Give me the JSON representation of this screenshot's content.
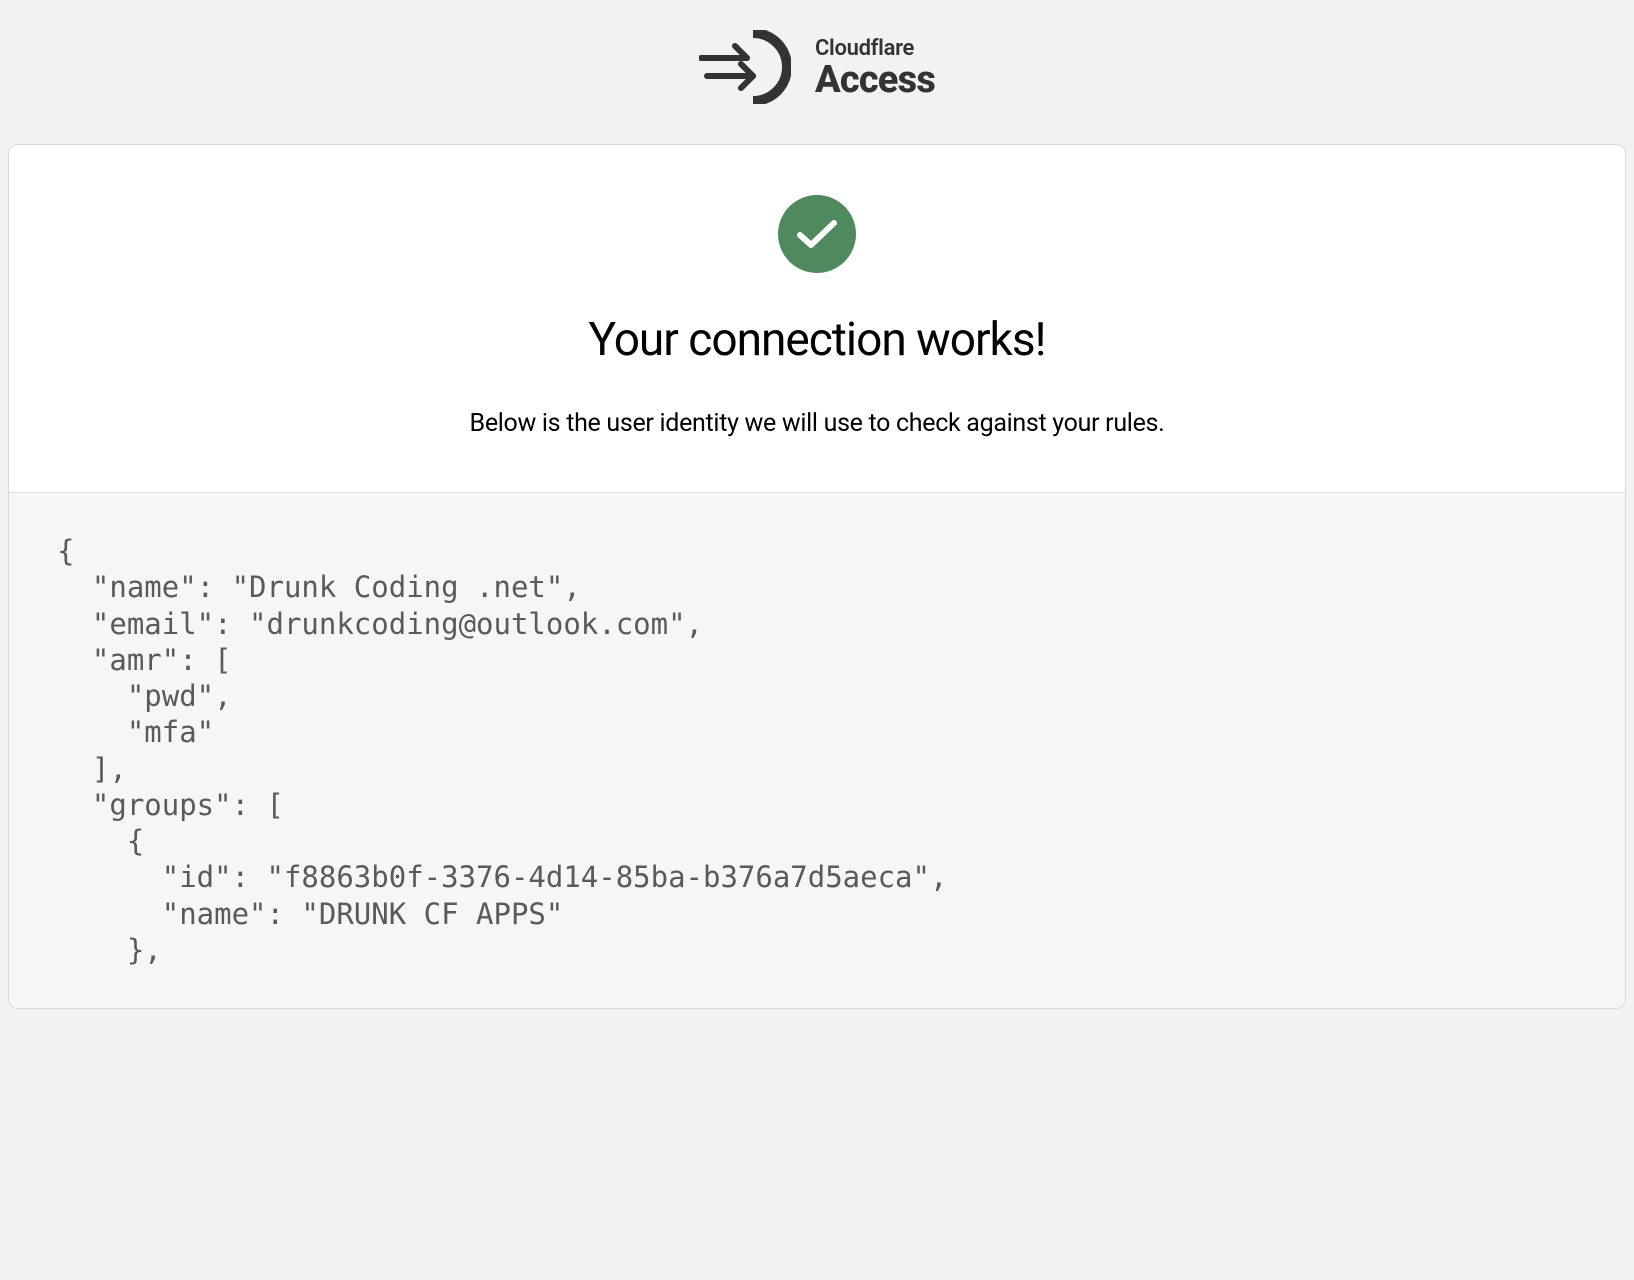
{
  "header": {
    "brand_line1": "Cloudflare",
    "brand_line2": "Access"
  },
  "card": {
    "title": "Your connection works!",
    "subtitle": "Below is the user identity we will use to check against your rules."
  },
  "identity_json_text": "{\n  \"name\": \"Drunk Coding .net\",\n  \"email\": \"drunkcoding@outlook.com\",\n  \"amr\": [\n    \"pwd\",\n    \"mfa\"\n  ],\n  \"groups\": [\n    {\n      \"id\": \"f8863b0f-3376-4d14-85ba-b376a7d5aeca\",\n      \"name\": \"DRUNK CF APPS\"\n    },"
}
